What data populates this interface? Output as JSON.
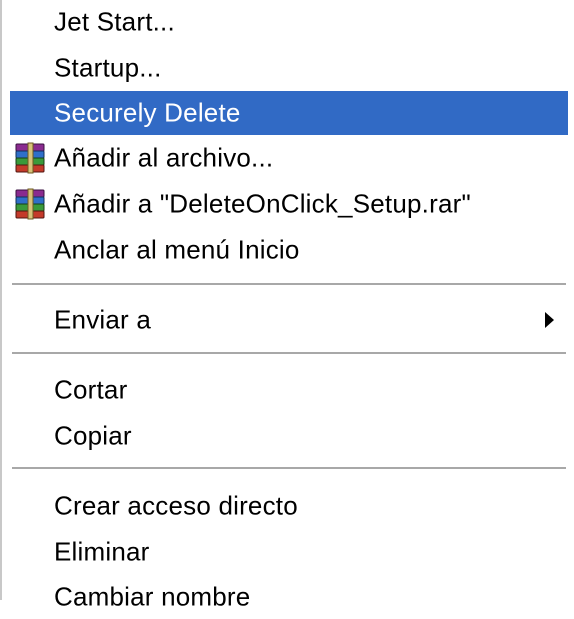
{
  "context_menu": {
    "items": [
      {
        "label": "Jet Start..."
      },
      {
        "label": "Startup..."
      },
      {
        "label": "Securely Delete"
      },
      {
        "label": "Añadir al archivo...",
        "icon": "winrar-archive-icon"
      },
      {
        "label": "Añadir a \"DeleteOnClick_Setup.rar\"",
        "icon": "winrar-archive-icon"
      },
      {
        "label": "Anclar al menú Inicio"
      },
      {
        "label": "Enviar a",
        "submenu_icon": "submenu-arrow-icon"
      },
      {
        "label": "Cortar"
      },
      {
        "label": "Copiar"
      },
      {
        "label": "Crear acceso directo"
      },
      {
        "label": "Eliminar"
      },
      {
        "label": "Cambiar nombre"
      }
    ],
    "highlighted_item": "Securely Delete",
    "colors": {
      "highlight_background": "#316ac5",
      "highlight_text": "#ffffff",
      "text": "#000000",
      "separator": "#a8a8a8",
      "background": "#ffffff"
    }
  }
}
